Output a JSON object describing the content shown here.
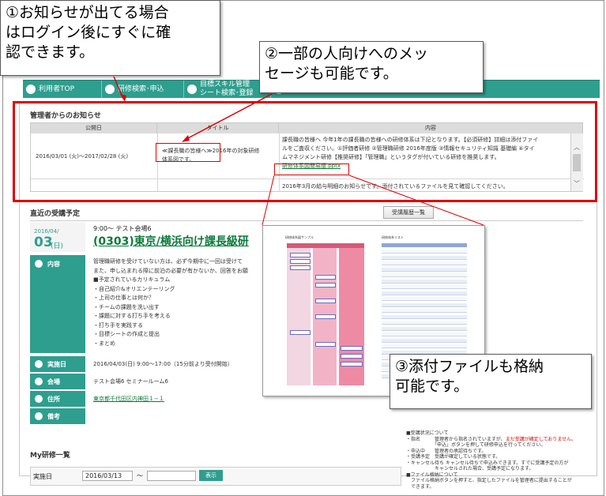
{
  "callouts": {
    "c1_line1": "①お知らせが出てる場合",
    "c1_line2": "はログイン後にすぐに確",
    "c1_line3": "認できます。",
    "c2_line1": "②一部の人向けへのメッ",
    "c2_line2": "セージも可能です。",
    "c3_line1": "③添付ファイルも格納",
    "c3_line2": "可能です。"
  },
  "tabs": [
    {
      "label": "利用者TOP"
    },
    {
      "label": "研修検索･申込"
    },
    {
      "label_line1": "目標スキル管理",
      "label_line2": "シート検索･登録"
    }
  ],
  "news": {
    "heading": "管理者からのお知らせ",
    "col_date": "公開日",
    "col_title": "タイトル",
    "col_content": "内容",
    "row1_date": "2016/03/01 (火)〜2017/02/28 (火)",
    "row1_title_a": "≪課長職の皆様へ≫2016年の対象研修",
    "row1_title_b": "体系図です。",
    "row1_content_a": "課長職の皆様へ 今年1年の課長職の皆様への研修体系は下記となります。【必須研修】詳細は添付ファイ",
    "row1_content_b": "ルをご査収ください。①評価者研修 ②管理職研修 2016年度版 ③情報セキュリティ知識 基礎編 ④タイ",
    "row1_content_c": "ムマネジメント研修【推奨研修】「管理職」というタグが付いている研修を推奨します。",
    "row1_attachment": "研修体系図簡易版.pptx",
    "row2_content": "2016年3月の給与明細のお知らせです。添付されているファイルを見て確認してください。"
  },
  "upcoming": {
    "heading": "直近の受講予定",
    "history_button": "受講履歴一覧",
    "date_ym": "2016/04/",
    "date_day": "03",
    "date_dow": "(日)",
    "time_place": "9:00〜 テスト会場6",
    "course_title": "(0303)東京/横浜向け課長級研",
    "label_content": "内容",
    "content_lines": [
      "管理職研修を受けていない方は、必ず今期中に一回は受けて",
      "また、申し込まれる際に前泊の必要が有かないか、回答をお願",
      "■予定されているカリキュラム",
      "・自己紹介&オリエンテーリング",
      "・上司の仕事とは何か？",
      "・チームの課題を洗い出す",
      "・課題に対する打ち手を考える",
      "・打ち手を実践する",
      "・目標シートの作成と提出",
      "・まとめ"
    ],
    "label_date": "実施日",
    "value_date": "2016/04/03(日) 9:00〜17:00（15分前より受付開始）",
    "label_venue": "会場",
    "value_venue": "テスト会場6 セミナールーム6",
    "label_address": "住所",
    "value_address": "東京都千代田区内神田１−１",
    "label_notes": "備考"
  },
  "preview": {
    "left_title": "研修体系図サンプル",
    "right_title": "研修体系リスト"
  },
  "status_notes": {
    "title": "■受講状況について",
    "l1": "・指名　　　管理者から指名されていますが、",
    "l1_red": "まだ受講が確定しておりません。",
    "l2": "　　　　　　「申込」ボタンを押して研修申込を行ってください。",
    "l3": "・申込中　　管理者の承認待ちです。",
    "l4": "・受講予定　受講が確定している状態です。",
    "l5": "・キャンセル待ち キャンセル待ちで申込みできます。すでに受講予定の方が",
    "l6": "　　　　　　キャンセルされた場合、受講予定になります。",
    "l7": "■ファイル格納について",
    "l8": "　ファイル格納ボタンを押すと、指定したファイルを管理者に提出することが",
    "l9": "　できます。"
  },
  "my_courses": {
    "heading": "My研修一覧",
    "label_date": "実施日",
    "date_from": "2016/03/13",
    "tilde": "〜",
    "date_to": "",
    "show_button": "表示"
  },
  "colors": {
    "accent": "#2e9e8f",
    "highlight": "#e00000"
  }
}
